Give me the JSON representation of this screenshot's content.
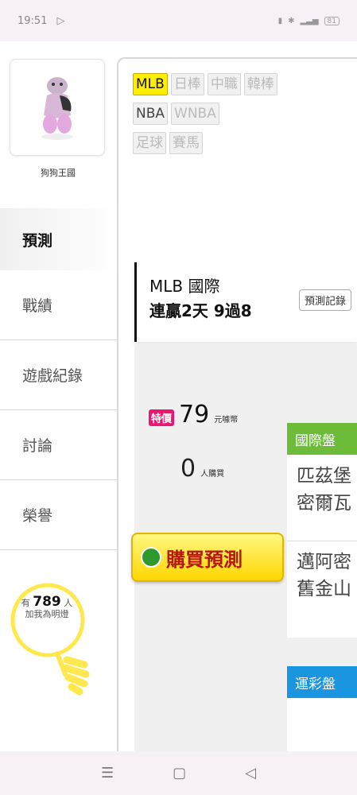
{
  "status_bar": {
    "time": "19:51",
    "battery": "81"
  },
  "profile": {
    "name": "狗狗王國"
  },
  "nav": {
    "items": [
      {
        "label": "預測"
      },
      {
        "label": "戰績"
      },
      {
        "label": "遊戲紀錄"
      },
      {
        "label": "討論"
      },
      {
        "label": "榮譽"
      }
    ]
  },
  "lamp": {
    "prefix": "有",
    "count": "789",
    "suffix": "人",
    "subtitle": "加我為明燈"
  },
  "tabs": {
    "row1": [
      "MLB",
      "日棒",
      "中職",
      "韓棒"
    ],
    "row2": [
      "NBA",
      "WNBA"
    ],
    "row3": [
      "足球",
      "賽馬"
    ]
  },
  "prediction": {
    "title": "MLB 國際",
    "streak": "連贏2天 9過8",
    "record_button": "預測記錄"
  },
  "offer": {
    "sale_tag": "特價",
    "price": "79",
    "price_unit": "元噱幣",
    "buyers_count": "0",
    "buyers_label": "人購買",
    "buy_button": "購買預測"
  },
  "international": {
    "header": "國際盤",
    "games": [
      {
        "line1": "匹茲堡",
        "line2": "密爾瓦"
      },
      {
        "line1": "邁阿密",
        "line2": "舊金山"
      }
    ]
  },
  "lottery": {
    "header": "運彩盤"
  },
  "colors": {
    "accent_yellow": "#ffee00",
    "sale_pink": "#e8186e",
    "intl_green": "#6cbc3a",
    "lottery_blue": "#1a96e0"
  }
}
